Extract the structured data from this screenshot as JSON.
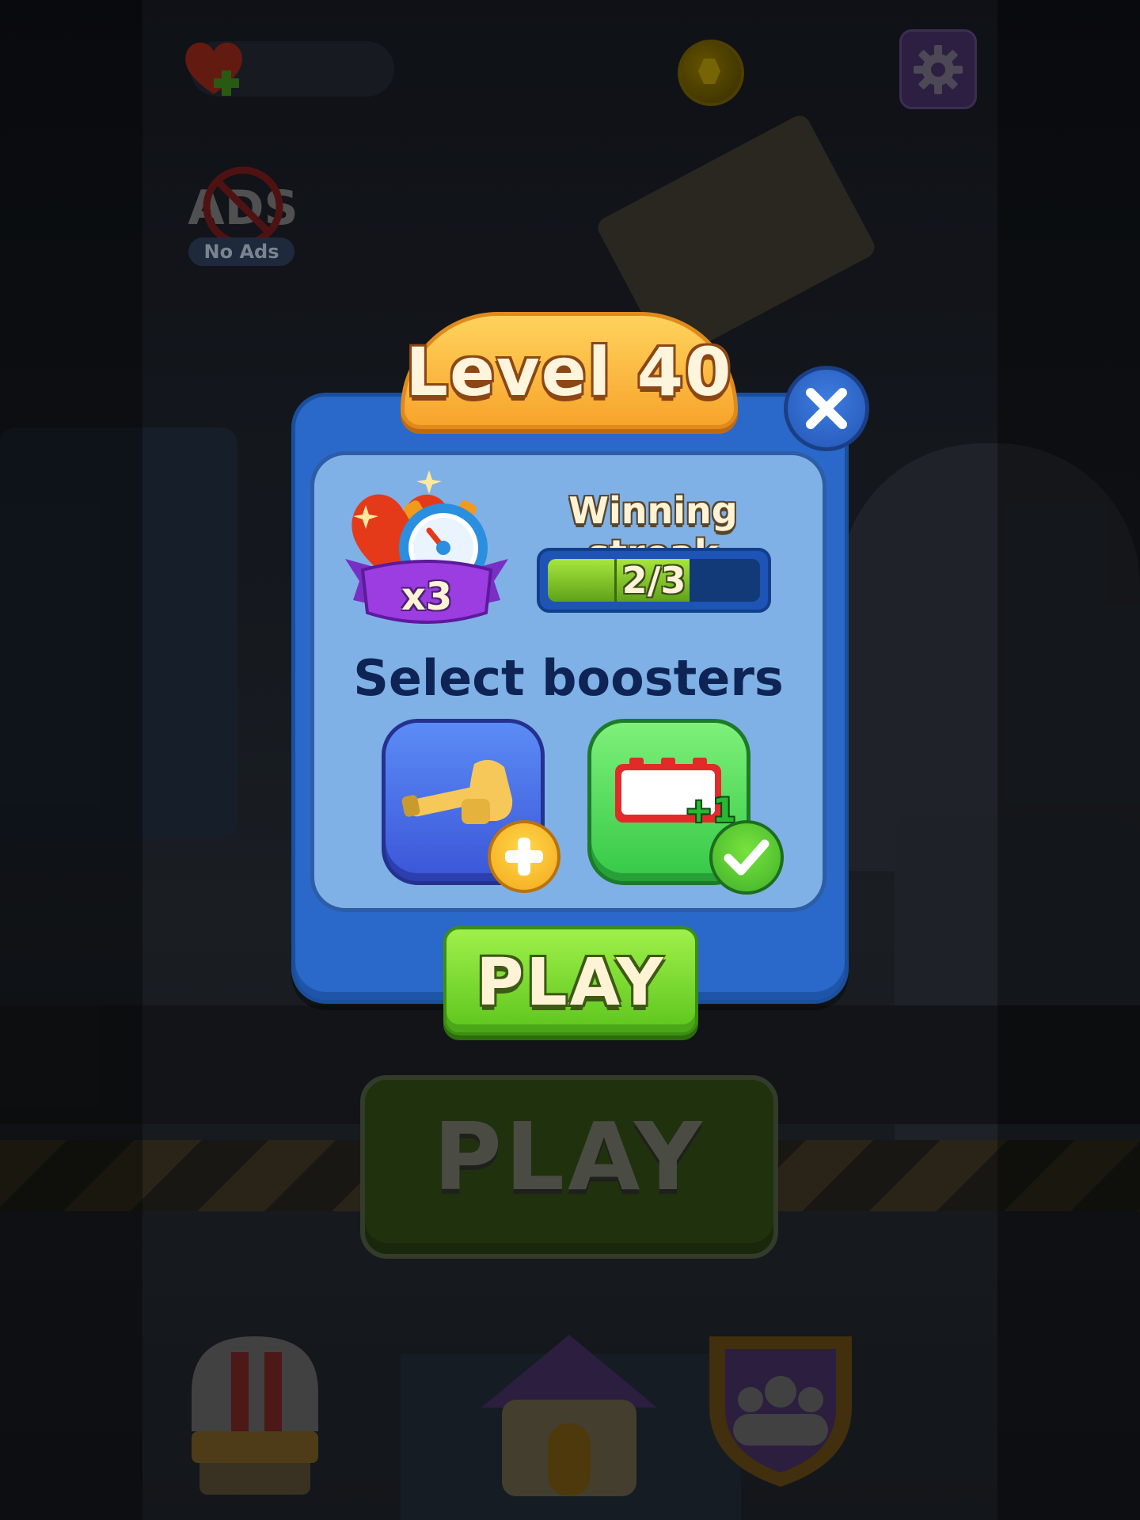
{
  "hud": {
    "noads_label": "No Ads"
  },
  "modal": {
    "title": "Level 40",
    "streak": {
      "title": "Winning streak",
      "progress_text": "2/3",
      "current": 2,
      "total": 3,
      "multiplier": "x3"
    },
    "boosters_title": "Select boosters",
    "boosters": [
      {
        "name": "hammer",
        "selected": false
      },
      {
        "name": "extra-moves",
        "badge": "+1",
        "selected": true
      }
    ],
    "play_label": "PLAY"
  },
  "background": {
    "play_label": "PLAY"
  },
  "colors": {
    "modal_blue": "#2a69c9",
    "panel_blue": "#7fb1e6",
    "title_orange": "#f7a42c",
    "play_green": "#5cc51c",
    "booster_blue": "#3a55d8",
    "booster_green": "#35c846"
  }
}
